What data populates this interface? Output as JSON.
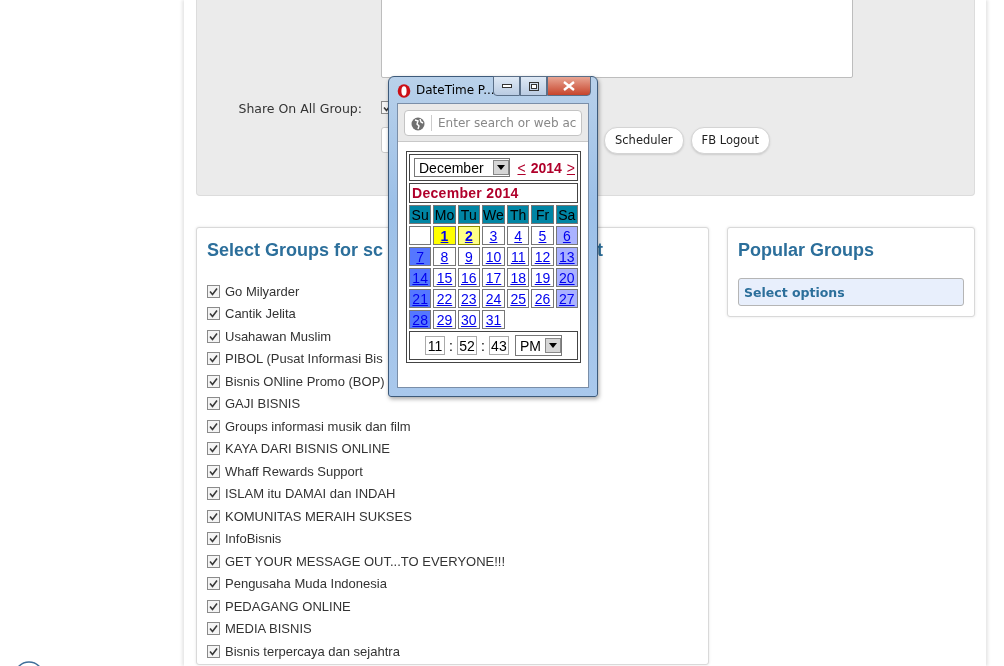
{
  "form": {
    "share_label": "Share On All Group:",
    "share_checked": true,
    "buttons": [
      "Scheduler",
      "FB Logout"
    ]
  },
  "groups_card": {
    "title_parts": [
      "Select Groups for sc",
      "t"
    ],
    "groups": [
      {
        "label": "Go Milyarder",
        "checked": true
      },
      {
        "label": "Cantik Jelita",
        "checked": true
      },
      {
        "label": "Usahawan Muslim",
        "checked": true
      },
      {
        "label": "PIBOL (Pusat Informasi Bis",
        "checked": true
      },
      {
        "label": "Bisnis ONline Promo (BOP)",
        "checked": true
      },
      {
        "label": "GAJI BISNIS",
        "checked": true
      },
      {
        "label": "Groups informasi musik dan film",
        "checked": true
      },
      {
        "label": "KAYA DARI BISNIS ONLINE",
        "checked": true
      },
      {
        "label": "Whaff Rewards Support",
        "checked": true
      },
      {
        "label": "ISLAM itu DAMAI dan INDAH",
        "checked": true
      },
      {
        "label": "KOMUNITAS MERAIH SUKSES",
        "checked": true
      },
      {
        "label": "InfoBisnis",
        "checked": true
      },
      {
        "label": "GET YOUR MESSAGE OUT...TO EVERYONE!!!",
        "checked": true
      },
      {
        "label": "Pengusaha Muda Indonesia",
        "checked": true
      },
      {
        "label": "PEDAGANG ONLINE",
        "checked": true
      },
      {
        "label": "MEDIA BISNIS",
        "checked": true
      },
      {
        "label": "Bisnis terpercaya dan sejahtra",
        "checked": true
      }
    ]
  },
  "popular_card": {
    "title": "Popular Groups",
    "select": "Select options"
  },
  "popup": {
    "title": "DateTime P...",
    "address_placeholder": "Enter search or web ac",
    "month": "December",
    "prev": "<",
    "year": "2014",
    "next": ">",
    "caption": "December 2014",
    "weekdays": [
      "Su",
      "Mo",
      "Tu",
      "We",
      "Th",
      "Fr",
      "Sa"
    ],
    "weeks": [
      [
        {
          "label": "1",
          "today": false,
          "selected": true
        },
        {
          "label": "2",
          "today": true,
          "selected": false
        },
        {
          "label": "3",
          "today": false,
          "selected": false
        },
        {
          "label": "4",
          "today": false,
          "selected": false
        },
        {
          "label": "5",
          "today": false,
          "selected": false
        },
        {
          "label": "6",
          "today": false,
          "selected": false
        }
      ],
      [
        {
          "label": "7",
          "today": false,
          "selected": false
        },
        {
          "label": "8",
          "today": false,
          "selected": false
        },
        {
          "label": "9",
          "today": false,
          "selected": false
        },
        {
          "label": "10",
          "today": false,
          "selected": false
        },
        {
          "label": "11",
          "today": false,
          "selected": false
        },
        {
          "label": "12",
          "today": false,
          "selected": false
        },
        {
          "label": "13",
          "today": false,
          "selected": false
        }
      ],
      [
        {
          "label": "14",
          "today": false,
          "selected": false
        },
        {
          "label": "15",
          "today": false,
          "selected": false
        },
        {
          "label": "16",
          "today": false,
          "selected": false
        },
        {
          "label": "17",
          "today": false,
          "selected": false
        },
        {
          "label": "18",
          "today": false,
          "selected": false
        },
        {
          "label": "19",
          "today": false,
          "selected": false
        },
        {
          "label": "20",
          "today": false,
          "selected": false
        }
      ],
      [
        {
          "label": "21",
          "today": false,
          "selected": false
        },
        {
          "label": "22",
          "today": false,
          "selected": false
        },
        {
          "label": "23",
          "today": false,
          "selected": false
        },
        {
          "label": "24",
          "today": false,
          "selected": false
        },
        {
          "label": "25",
          "today": false,
          "selected": false
        },
        {
          "label": "26",
          "today": false,
          "selected": false
        },
        {
          "label": "27",
          "today": false,
          "selected": false
        }
      ],
      [
        {
          "label": "28",
          "today": false,
          "selected": false
        },
        {
          "label": "29",
          "today": false,
          "selected": false
        },
        {
          "label": "30",
          "today": false,
          "selected": false
        },
        {
          "label": "31",
          "today": false,
          "selected": false
        }
      ]
    ],
    "time": {
      "hour": "11",
      "separator_1": ":",
      "minute": "52",
      "separator_2": ":",
      "second": "43",
      "ampm": "PM"
    }
  }
}
